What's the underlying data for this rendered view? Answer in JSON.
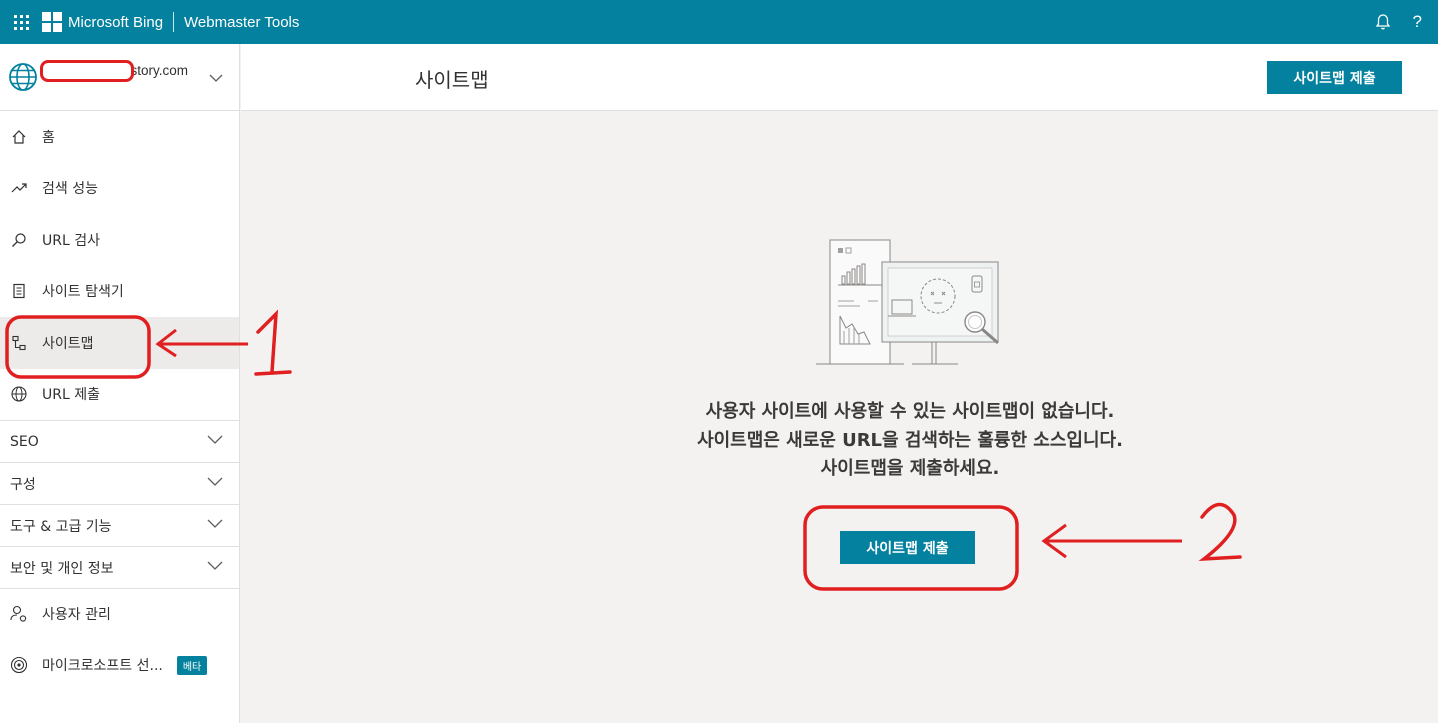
{
  "colors": {
    "accent": "#04819e",
    "annotation": "#e02020"
  },
  "topbar": {
    "brand": "Microsoft Bing",
    "product": "Webmaster Tools",
    "help": "?"
  },
  "sidebar": {
    "site": ".tistory.com",
    "items": [
      {
        "label": "홈",
        "icon": "home-icon"
      },
      {
        "label": "검색 성능",
        "icon": "trend-icon"
      },
      {
        "label": "URL 검사",
        "icon": "search-icon"
      },
      {
        "label": "사이트 탐색기",
        "icon": "document-icon"
      },
      {
        "label": "사이트맵",
        "icon": "sitemap-icon",
        "active": true
      },
      {
        "label": "URL 제출",
        "icon": "globe-icon"
      }
    ],
    "groups": [
      {
        "label": "SEO"
      },
      {
        "label": "구성"
      },
      {
        "label": "도구 & 고급 기능"
      },
      {
        "label": "보안 및 개인 정보"
      }
    ],
    "bottom_items": [
      {
        "label": "사용자 관리",
        "icon": "user-settings-icon"
      },
      {
        "label": "마이크로소프트 선...",
        "icon": "radar-icon",
        "badge": "베타"
      }
    ]
  },
  "main": {
    "title": "사이트맵",
    "submit_label": "사이트맵 제출",
    "empty_lines": [
      "사용자 사이트에 사용할 수 있는 사이트맵이 없습니다.",
      "사이트맵은 새로운 URL을 검색하는 훌륭한 소스입니다.",
      "사이트맵을 제출하세요."
    ],
    "empty_button": "사이트맵 제출"
  },
  "annotations": {
    "one": "1",
    "two": "2"
  }
}
